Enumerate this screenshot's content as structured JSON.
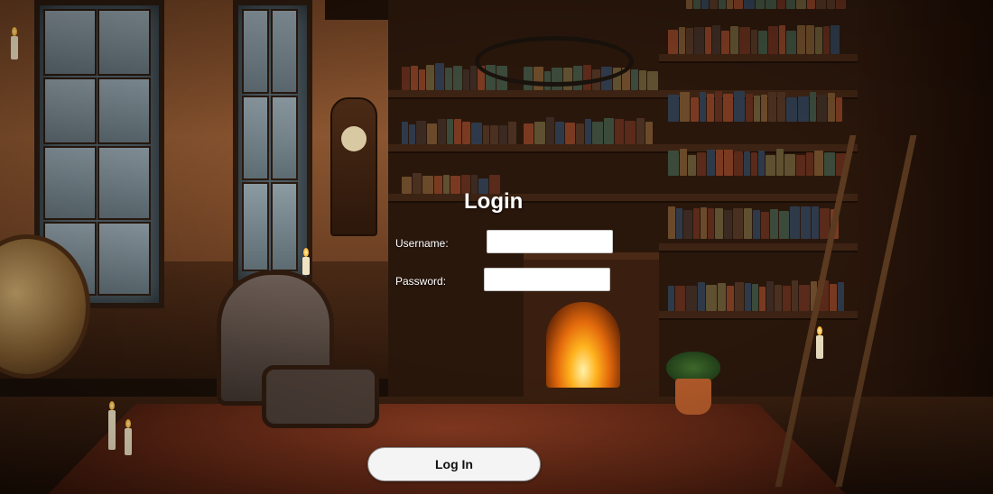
{
  "login": {
    "title": "Login",
    "username_label": "Username:",
    "username_value": "",
    "password_label": "Password:",
    "password_value": "",
    "submit_label": "Log In"
  },
  "background": {
    "description_icon": "library-room-background",
    "accent_color": "#e47a1c"
  }
}
